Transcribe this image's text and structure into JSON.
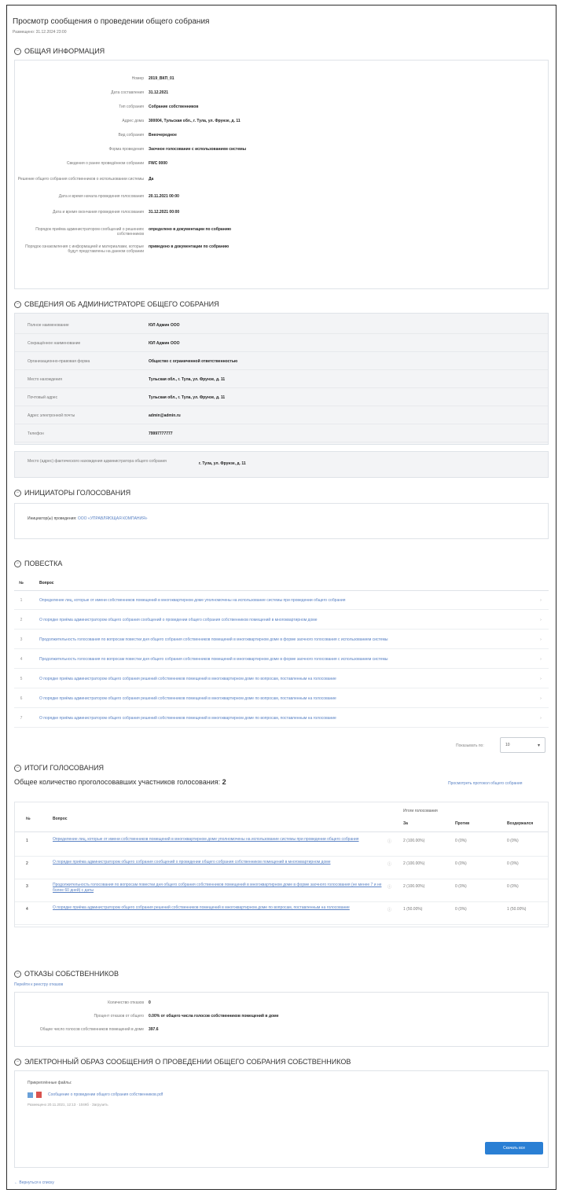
{
  "header": {
    "title": "Просмотр сообщения о проведении общего собрания",
    "subtitle": "Размещено: 31.12.2024 23:00"
  },
  "sections": {
    "general": "ОБЩАЯ ИНФОРМАЦИЯ",
    "admin": "СВЕДЕНИЯ ОБ АДМИНИСТРАТОРЕ ОБЩЕГО СОБРАНИЯ",
    "initiators": "ИНИЦИАТОРЫ ГОЛОСОВАНИЯ",
    "agenda": "ПОВЕСТКА",
    "results": "ИТОГИ ГОЛОСОВАНИЯ",
    "refusals": "ОТКАЗЫ СОБСТВЕННИКОВ",
    "electronic": "ЭЛЕКТРОННЫЙ ОБРАЗ СООБЩЕНИЯ О ПРОВЕДЕНИИ ОБЩЕГО СОБРАНИЯ СОБСТВЕННИКОВ"
  },
  "general_info": [
    {
      "k": "Номер",
      "v": "2019_ВКП_01"
    },
    {
      "k": "Дата составления",
      "v": "31.12.2021"
    },
    {
      "k": "Тип собрания",
      "v": "Собрание собственников"
    },
    {
      "k": "Адрес дома",
      "v": "300004, Тульская обл., г. Тула, ул. Фрунзе, д. 11"
    },
    {
      "k": "Вид собрания",
      "v": "Внеочередное"
    },
    {
      "k": "Форма проведения",
      "v": "Заочное голосование с использованием системы"
    },
    {
      "k": "Сведения о ранее проведённом собрании",
      "v": "FWC 0000"
    },
    {
      "k": "Решение общего собрания собственников о использовании системы",
      "v": "Да"
    },
    {
      "k": "Дата и время начала проведения голосования",
      "v": "20.11.2021 00:00"
    },
    {
      "k": "Дата и время окончания проведения голосования",
      "v": "31.12.2021 00:00"
    },
    {
      "k": "Порядок приёма администратором сообщений о решениях собственников",
      "v": "определено в документации по собранию"
    },
    {
      "k": "Порядок ознакомления с информацией и материалами, которые будут представлены на данном собрании",
      "v": "приведено в документации по собранию"
    }
  ],
  "admin_info": [
    {
      "k": "Полное наименование",
      "v": "ЮЛ Админ ООО"
    },
    {
      "k": "Сокращённое наименование",
      "v": "ЮЛ Админ ООО"
    },
    {
      "k": "Организационно-правовая форма",
      "v": "Общество с ограниченной ответственностью"
    },
    {
      "k": "Место нахождения",
      "v": "Тульская обл., г. Тула, ул. Фрунзе, д. 11"
    },
    {
      "k": "Почтовый адрес",
      "v": "Тульская обл., г. Тула, ул. Фрунзе, д. 11"
    },
    {
      "k": "Адрес электронной почты",
      "v": "admin@admin.ru"
    },
    {
      "k": "Телефон",
      "v": "79997777777"
    }
  ],
  "admin_place": {
    "k": "Место (адрес) фактического нахождения администратора общего собрания",
    "v": "г. Тула, ул. Фрунзе, д. 11"
  },
  "initiators": {
    "label": "Инициатор(ы) проведения:",
    "value": "ООО «УПРАВЛЯЮЩАЯ КОМПАНИЯ»"
  },
  "agenda": {
    "col_n": "№",
    "col_q": "Вопрос",
    "items": [
      {
        "n": "1",
        "t": "Определение лиц, которые от имени собственников помещений в многоквартирном доме уполномочены на использование системы при проведении общего собрания"
      },
      {
        "n": "2",
        "t": "О порядке приёма администратором общего собрания сообщений о проведении общего собрания собственников помещений в многоквартирном доме"
      },
      {
        "n": "3",
        "t": "Продолжительность голосования по вопросам повестки дня общего собрания собственников помещений в многоквартирном доме в форме заочного голосования с использованием системы"
      },
      {
        "n": "4",
        "t": "Продолжительность голосования по вопросам повестки дня общего собрания собственников помещений в многоквартирном доме в форме заочного голосования с использованием системы"
      },
      {
        "n": "5",
        "t": "О порядке приёма администратором общего собрания решений собственников помещений в многоквартирном доме по вопросам, поставленным на голосование"
      },
      {
        "n": "6",
        "t": "О порядке приёма администратором общего собрания решений собственников помещений в многоквартирном доме по вопросам, поставленным на голосование"
      },
      {
        "n": "7",
        "t": "О порядке приёма администратором общего собрания решений собственников помещений в многоквартирном доме по вопросам, поставленным на голосование"
      }
    ],
    "page_size_label": "Показывать по:",
    "page_size": "10"
  },
  "results": {
    "total_label": "Общее количество проголосовавших участников голосования:",
    "total": "2",
    "protocol_link": "Просмотреть протокол общего собрания",
    "col_n": "№",
    "col_q": "Вопрос",
    "col_group": "Итоги голосования",
    "col_for": "За",
    "col_against": "Против",
    "col_abstain": "Воздержался",
    "rows": [
      {
        "n": "1",
        "q": "Определение лиц, которые от имени собственников помещений в многоквартирном доме уполномочены на использование системы при проведении общего собрания",
        "for": "2 (100.00%)",
        "against": "0 (0%)",
        "abstain": "0 (0%)"
      },
      {
        "n": "2",
        "q": "О порядке приёма администратором общего собрания сообщений о проведении общего собрания собственников помещений в многоквартирном доме",
        "for": "2 (100.00%)",
        "against": "0 (0%)",
        "abstain": "0 (0%)"
      },
      {
        "n": "3",
        "q": "Продолжительность голосования по вопросам повестки дня общего собрания собственников помещений в многоквартирном доме в форме заочного голосования (не менее 7 и не более 60 дней) с даты",
        "for": "2 (100.00%)",
        "against": "0 (0%)",
        "abstain": "0 (0%)"
      },
      {
        "n": "4",
        "q": "О порядке приёма администратором общего собрания решений собственников помещений в многоквартирном доме по вопросам, поставленным на голосование",
        "for": "1 (50.00%)",
        "against": "0 (0%)",
        "abstain": "1 (50.00%)"
      }
    ]
  },
  "refusals": {
    "sublink": "Перейти к реестру отказов",
    "rows": [
      {
        "k": "Количество отказов",
        "v": "0"
      },
      {
        "k": "Процент отказов от общего",
        "v": "0.00% от общего числа голосов собственников помещений в доме"
      },
      {
        "k": "Общее число голосов собственников помещений в доме",
        "v": "397.6"
      }
    ]
  },
  "electronic": {
    "files_label": "Прикреплённые файлы:",
    "file_name": "Сообщение о проведении общего собрания собственников.pdf",
    "file_meta": "Размещено 20.11.2021, 12:13 · 104Кб · Загрузить",
    "download_all": "Скачать все"
  },
  "back_link": "← Вернуться к списку"
}
